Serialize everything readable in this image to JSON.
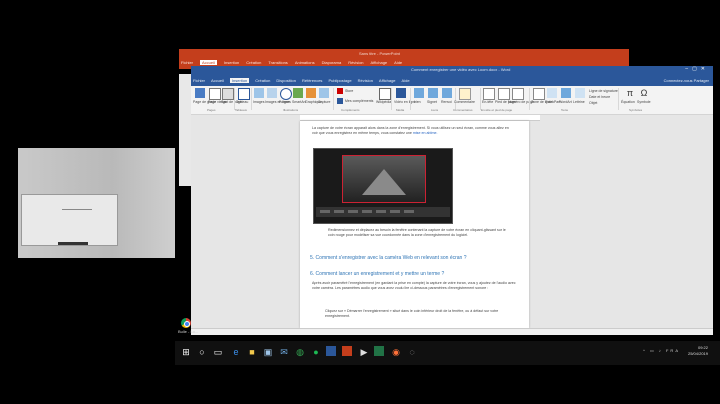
{
  "ppt": {
    "title": "Sans titre - PowerPoint",
    "tabs": [
      "Fichier",
      "Accueil",
      "Insertion",
      "Création",
      "Transitions",
      "Animations",
      "Diaporama",
      "Révision",
      "Affichage",
      "Aide"
    ]
  },
  "word": {
    "title": "Comment enregistrer une vidéo avec Loom.docx - Word",
    "tabs": [
      "Fichier",
      "Accueil",
      "Insertion",
      "Création",
      "Disposition",
      "Références",
      "Publipostage",
      "Révision",
      "Affichage",
      "Aide"
    ],
    "active_tab": "Insertion",
    "right_tabs": "Connectez-vous  Partager",
    "ribbon_groups": [
      "Pages",
      "Tableaux",
      "Illustrations",
      "Compléments",
      "Média",
      "Liens",
      "Commentaires",
      "En-tête et pied de page",
      "Texte",
      "Symboles"
    ],
    "ribbon_items": [
      "Page de garde",
      "Page vierge",
      "Saut de page",
      "Tableau",
      "Images",
      "Images en ligne",
      "Formes",
      "SmartArt",
      "Graphique",
      "Capture",
      "Store",
      "Mes compléments",
      "Wikipédia",
      "Vidéo en ligne",
      "Lien",
      "Signet",
      "Renvoi",
      "Commentaire",
      "En-tête",
      "Pied de page",
      "Numéro de page",
      "Zone de texte",
      "QuickPart",
      "WordArt",
      "Lettrine",
      "Ligne de signature",
      "Date et heure",
      "Objet",
      "Équation",
      "Symbole"
    ]
  },
  "document": {
    "intro": "La capture de votre écran apparait alors dans la zone d'enregistrement. Si vous utilisez un seul écran, comme vous allez en voir que vous enregistrez en même temps, vous constatez une",
    "link": "mise en abîme.",
    "caption": "Redimensionnez et déplacez au besoin la fenêtre contenant la capture de votre écran en cliquant-glissant sur le coin rouge pour modéliser sa vue coordonnée dans la zone d'enregistrement du logiciel.",
    "heading1": "5. Comment s'enregistrer avec la caméra Web en relevant son écran ?",
    "heading2": "6. Comment lancer un enregistrement et y mettre un terme ?",
    "para": "Après avoir paramétré l'enregistrement (en gardant la prise en compte) la capture de votre écran, vous y ajoutez de l'audio avec votre caméra. Les paramètres audio que vous avez voulu lire ci-dessous paramètres d'enregistrement sonore :",
    "bullet": "Cliquez sur « Démarrer l'enregistrement » situé dans le coin inférieur droit de la fenêtre, ou à défaut sur votre enregistrement."
  },
  "taskbar": {
    "chrome_label": "Bulle - Lo...",
    "icons": [
      "windows-start-icon",
      "search-icon",
      "task-view-icon",
      "edge-icon",
      "file-explorer-icon",
      "store-icon",
      "mail-icon",
      "chrome-icon",
      "spotify-icon",
      "word-icon",
      "powerpoint-icon",
      "media-icon",
      "excel-icon",
      "firefox-icon",
      "loom-icon"
    ],
    "tray": "^ ▭ ♪ FRA",
    "time": "09:22",
    "date": "25/04/2019"
  },
  "colors": {
    "word_blue": "#2b579a",
    "ppt_red": "#c43e1c",
    "heading_blue": "#2e74b5"
  }
}
